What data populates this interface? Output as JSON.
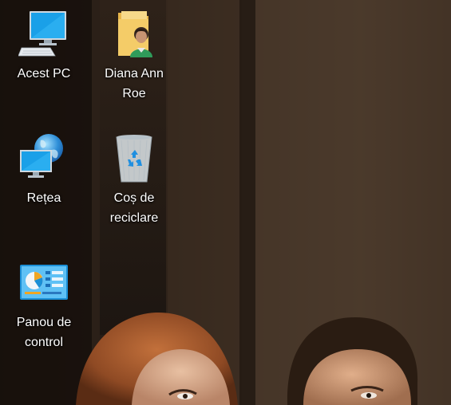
{
  "desktop": {
    "icons": [
      {
        "id": "this-pc",
        "label": "Acest PC",
        "icon": "computer-icon"
      },
      {
        "id": "user-folder",
        "label": "Diana Ann Roe",
        "icon": "user-folder-icon"
      },
      {
        "id": "network",
        "label": "Rețea",
        "icon": "network-icon"
      },
      {
        "id": "recycle-bin",
        "label": "Coș de reciclare",
        "icon": "recycle-bin-icon"
      },
      {
        "id": "control-panel",
        "label": "Panou de control",
        "icon": "control-panel-icon"
      }
    ]
  }
}
